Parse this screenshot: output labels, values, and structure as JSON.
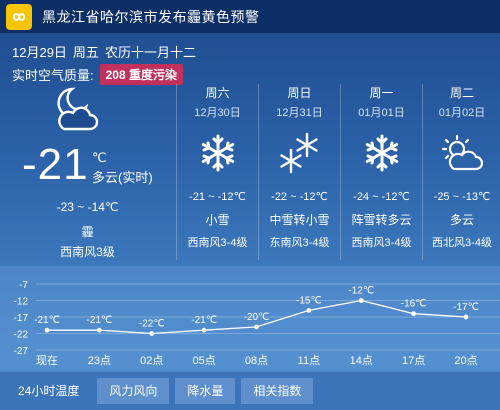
{
  "alert": {
    "icon": "infinity-icon",
    "text": "黑龙江省哈尔滨市发布霾黄色预警"
  },
  "today": {
    "date": "12月29日",
    "weekday": "周五",
    "lunar": "农历十一月十二",
    "aqi_label": "实时空气质量:",
    "aqi_value": "208 重度污染",
    "temp": "-21",
    "unit": "℃",
    "desc": "多云(实时)",
    "range": "-23 ~ -14℃",
    "condition": "霾",
    "wind": "西南风3级",
    "icon": "moon-cloud-icon"
  },
  "forecast": [
    {
      "day": "周六",
      "date": "12月30日",
      "range": "-21 ~ -12℃",
      "condition": "小雪",
      "wind": "西南风3-4级",
      "icon": "snowflake-icon"
    },
    {
      "day": "周日",
      "date": "12月31日",
      "range": "-22 ~ -12℃",
      "condition": "中雪转小雪",
      "wind": "东南风3-4级",
      "icon": "double-snowflake-icon"
    },
    {
      "day": "周一",
      "date": "01月01日",
      "range": "-24 ~ -12℃",
      "condition": "阵雪转多云",
      "wind": "西南风3-4级",
      "icon": "snowflake-icon"
    },
    {
      "day": "周二",
      "date": "01月02日",
      "range": "-25 ~ -13℃",
      "condition": "多云",
      "wind": "西北风3-4级",
      "icon": "sun-cloud-icon"
    }
  ],
  "chart_data": {
    "type": "line",
    "title": "",
    "x": [
      "现在",
      "23点",
      "02点",
      "05点",
      "08点",
      "11点",
      "14点",
      "17点",
      "20点"
    ],
    "values": [
      -21,
      -21,
      -22,
      -21,
      -20,
      -15,
      -12,
      -16,
      -17
    ],
    "point_labels": [
      "-21℃",
      "-21℃",
      "-22℃",
      "-21℃",
      "-20℃",
      "-15℃",
      "-12℃",
      "-16℃",
      "-17℃"
    ],
    "yticks": [
      -7,
      -12,
      -17,
      -22,
      -27
    ],
    "ylim": [
      -27,
      -7
    ],
    "grid": true
  },
  "tabs": [
    "24小时温度",
    "风力风向",
    "降水量",
    "相关指数"
  ]
}
